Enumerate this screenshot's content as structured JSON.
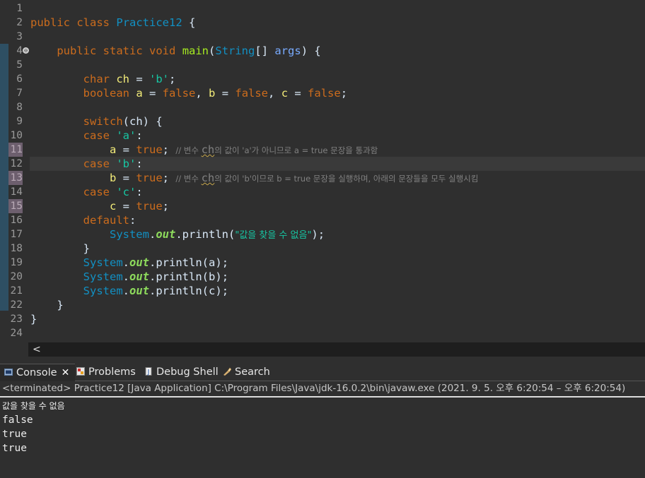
{
  "editor": {
    "class_name": "Practice12",
    "method_name": "main",
    "param_type": "String",
    "param_name": "args",
    "var_ch": "ch",
    "char_value": "'b'",
    "var_a": "a",
    "var_b": "b",
    "var_c": "c",
    "case_a": "'a'",
    "case_b": "'b'",
    "case_c": "'c'",
    "comment_11_pre": "// 변수 ",
    "comment_11_ch": "ch",
    "comment_11_post": "의 값이 'a'가 아니므로 a = true 문장을 통과함",
    "comment_13_pre": "// 변수 ",
    "comment_13_ch": "ch",
    "comment_13_post": "의 값이 'b'이므로 b = true 문장을 실행하며, 아래의 문장들을 모두 실행시킴",
    "default_string": "\"값을 찾을 수 없음\"",
    "system": "System",
    "out": "out",
    "println": "println",
    "line_numbers": [
      "1",
      "2",
      "3",
      "4",
      "5",
      "6",
      "7",
      "8",
      "9",
      "10",
      "11",
      "12",
      "13",
      "14",
      "15",
      "16",
      "17",
      "18",
      "19",
      "20",
      "21",
      "22",
      "23",
      "24"
    ],
    "fold_marker": "⊖"
  },
  "panel": {
    "tabs": {
      "console": "Console",
      "problems": "Problems",
      "debug_shell": "Debug Shell",
      "search": "Search"
    },
    "close_glyph": "✕",
    "terminated_text": "<terminated> Practice12 [Java Application] C:\\Program Files\\Java\\jdk-16.0.2\\bin\\javaw.exe  (2021. 9. 5. 오후 6:20:54 – 오후 6:20:54)",
    "output_lines": [
      "값을 찾을 수 없음",
      "false",
      "true",
      "true"
    ]
  },
  "scroll_left_glyph": "<",
  "colors": {
    "background": "#2f2f2f",
    "keyword": "#cc6c1d",
    "class": "#1290c3",
    "method": "#a7ec21",
    "string": "#17c6a3",
    "variable": "#f3ec79",
    "comment": "#808080"
  }
}
